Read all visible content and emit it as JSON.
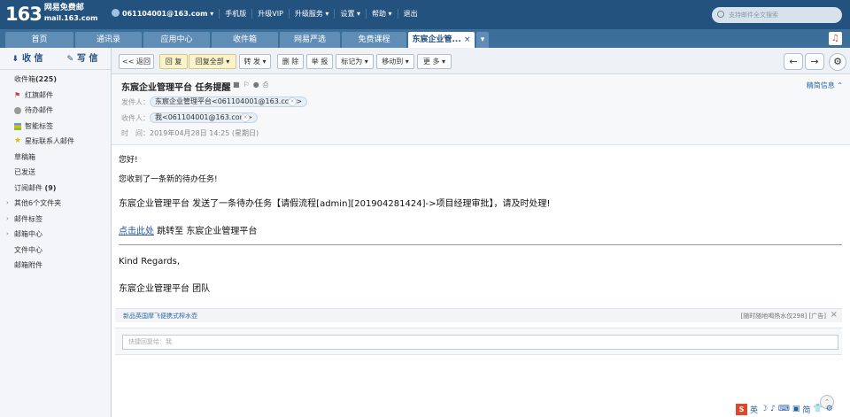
{
  "logo": {
    "number": "163",
    "line1": "网易免费邮",
    "line2": "mail.163.com"
  },
  "topnav": {
    "account": "061104001@163.com",
    "items": [
      "手机版",
      "升级VIP",
      "升级服务",
      "设置",
      "帮助",
      "退出"
    ]
  },
  "search": {
    "placeholder": "支持邮件全文搜索"
  },
  "tabs": [
    "首页",
    "通讯录",
    "应用中心",
    "收件箱",
    "网易严选",
    "免费课程",
    "东宸企业管..."
  ],
  "sidebar": {
    "receive_label": "收 信",
    "compose_label": "写 信",
    "folders": [
      {
        "label": "收件箱",
        "count": "(225)"
      },
      {
        "label": "红旗邮件"
      },
      {
        "label": "待办邮件"
      },
      {
        "label": "智能标签"
      },
      {
        "label": "星标联系人邮件"
      },
      {
        "label": "草稿箱"
      },
      {
        "label": "已发送"
      },
      {
        "label": "订阅邮件",
        "count": "(9)"
      },
      {
        "label": "其他6个文件夹"
      },
      {
        "label": "邮件标签"
      },
      {
        "label": "邮箱中心"
      },
      {
        "label": "文件中心"
      },
      {
        "label": "邮箱附件"
      }
    ]
  },
  "toolbar": {
    "back": "<< 返回",
    "reply": "回 复",
    "reply_all": "回复全部",
    "forward": "转 发",
    "delete": "删 除",
    "report": "举 报",
    "mark_as": "标记为",
    "move_to": "移动到",
    "more": "更 多",
    "prev": "←",
    "next": "→",
    "settings": "⚙"
  },
  "message": {
    "subject": "东宸企业管理平台 任务提醒",
    "pretty_info": "精简信息",
    "sender_label": "发件人：",
    "sender": "东宸企业管理平台<061104001@163.com>",
    "recipient_label": "收件人：",
    "recipient": "我<061104001@163.com>",
    "time_label": "时　间：",
    "time": "2019年04月28日 14:25 (星期日)"
  },
  "body": {
    "greeting": "您好!",
    "line1": "您收到了一条新的待办任务!",
    "line2": "东宸企业管理平台 发送了一条待办任务【请假流程[admin][201904281424]->项目经理审批】，请及时处理!",
    "link_text": "点击此处",
    "link_after": " 跳转至 东宸企业管理平台",
    "regards": "Kind Regards,",
    "team": "东宸企业管理平台 团队"
  },
  "ad": {
    "left": "新品英国摩飞便携式榨水壶",
    "right": "[随时随地喝热水仅298] [广告]"
  },
  "quick_reply": {
    "placeholder": "快捷回复给：我"
  },
  "tray": [
    "S",
    "英",
    "☽",
    "♪",
    "⌨",
    "▣",
    "简",
    "👕",
    "⚙"
  ]
}
